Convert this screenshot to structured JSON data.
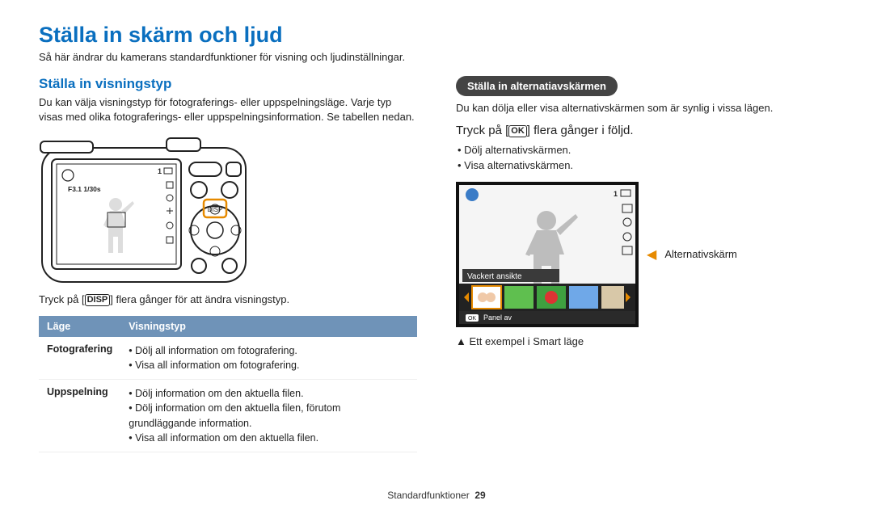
{
  "title": "Ställa in skärm och ljud",
  "intro": "Så här ändrar du kamerans standardfunktioner för visning och ljudinställningar.",
  "left": {
    "heading": "Ställa in visningstyp",
    "para": "Du kan välja visningstyp för fotograferings- eller uppspelningsläge. Varje typ visas med olika fotograferings- eller uppspelningsinformation. Se tabellen nedan.",
    "screen_text": "F3.1 1/30s",
    "disp_btn": "DISP",
    "caption_pre": "Tryck på [",
    "caption_btn": "DISP",
    "caption_post": "] flera gånger för att ändra visningstyp.",
    "th_mode": "Läge",
    "th_type": "Visningstyp",
    "rows": [
      {
        "mode": "Fotografering",
        "items": [
          "Dölj all information om fotografering.",
          "Visa all information om fotografering."
        ]
      },
      {
        "mode": "Uppspelning",
        "items": [
          "Dölj information om den aktuella filen.",
          "Dölj information om den aktuella filen, förutom grundläggande information.",
          "Visa all information om den aktuella filen."
        ]
      }
    ]
  },
  "right": {
    "pill": "Ställa in alternatiavskärmen",
    "para": "Du kan dölja eller visa alternativskärmen som är synlig i vissa lägen.",
    "step_pre": "Tryck på [",
    "step_btn": "OK",
    "step_post": "] flera gånger i följd.",
    "bullets": [
      "Dölj alternativskärmen.",
      "Visa alternativskärmen."
    ],
    "screen_label": "Vackert ansikte",
    "panel_off": "Panel av",
    "arrow_label": "Alternativskärm",
    "example": "▲ Ett exempel i Smart läge"
  },
  "footer_label": "Standardfunktioner",
  "footer_page": "29"
}
